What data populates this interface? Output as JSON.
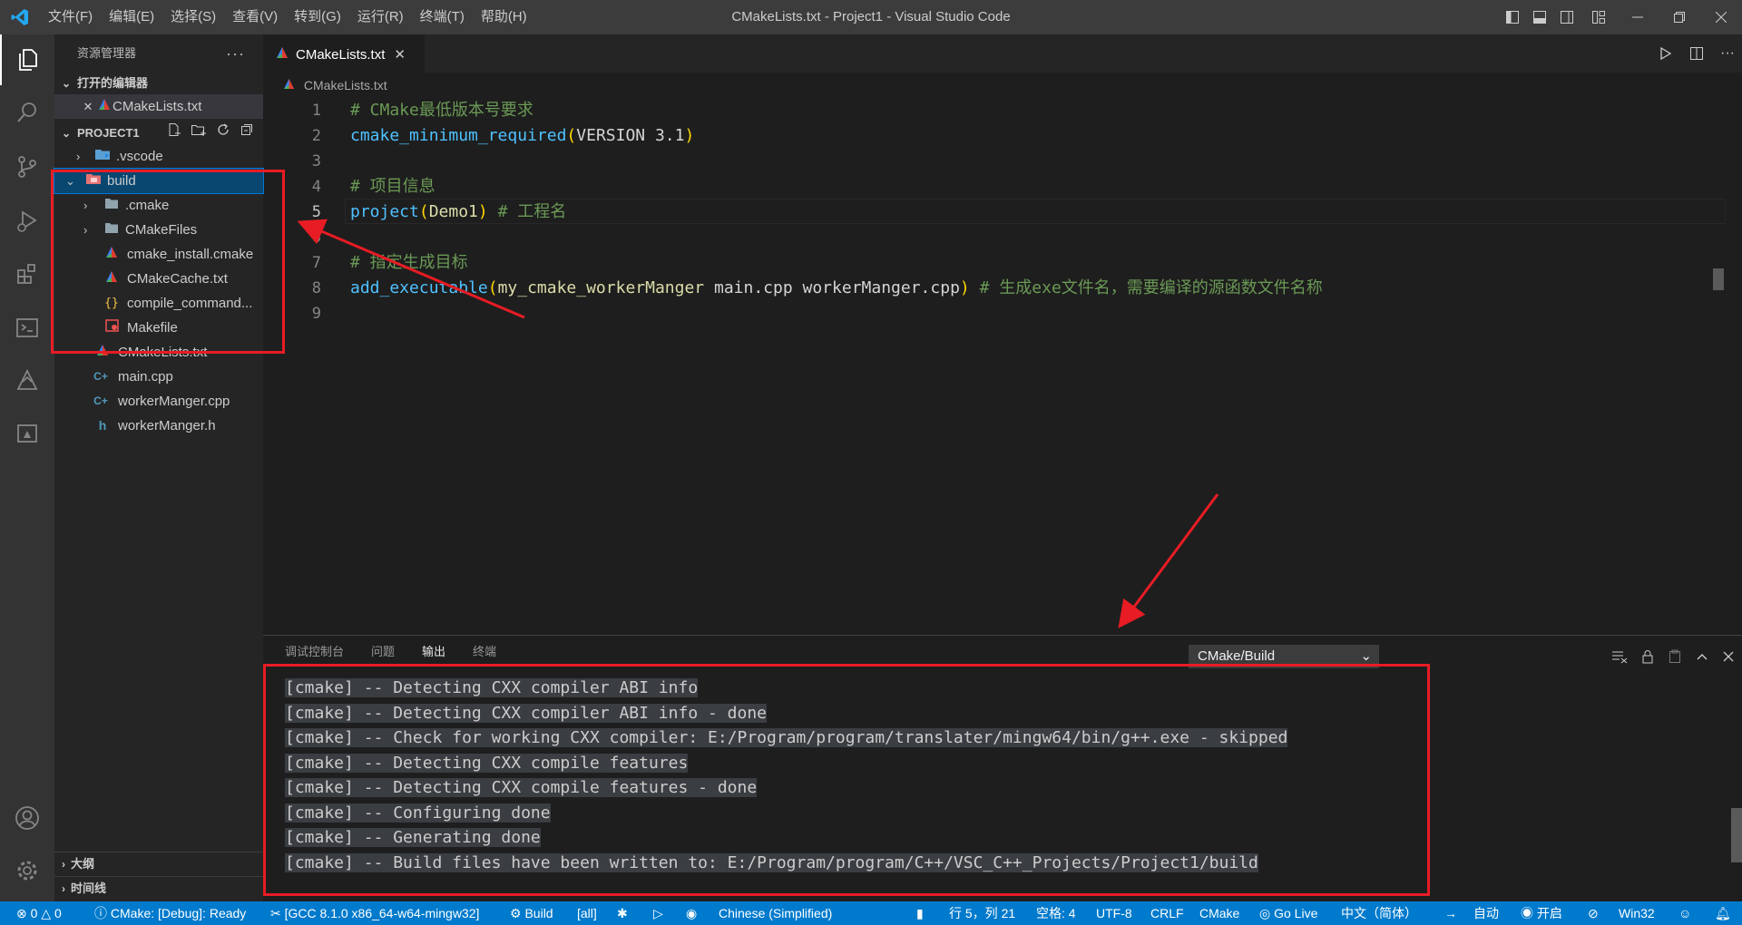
{
  "window": {
    "title": "CMakeLists.txt - Project1 - Visual Studio Code"
  },
  "menu": [
    "文件(F)",
    "编辑(E)",
    "选择(S)",
    "查看(V)",
    "转到(G)",
    "运行(R)",
    "终端(T)",
    "帮助(H)"
  ],
  "sidebar": {
    "title": "资源管理器",
    "open_editors_label": "打开的编辑器",
    "open_editor_file": "CMakeLists.txt",
    "project_label": "PROJECT1",
    "tree": [
      {
        "label": ".vscode",
        "indent": 1,
        "type": "folder-vscode"
      },
      {
        "label": "build",
        "indent": 1,
        "type": "folder-open"
      },
      {
        "label": ".cmake",
        "indent": 2,
        "type": "folder"
      },
      {
        "label": "CMakeFiles",
        "indent": 2,
        "type": "folder"
      },
      {
        "label": "cmake_install.cmake",
        "indent": 3,
        "type": "cmake"
      },
      {
        "label": "CMakeCache.txt",
        "indent": 3,
        "type": "cmake"
      },
      {
        "label": "compile_command...",
        "indent": 3,
        "type": "json"
      },
      {
        "label": "Makefile",
        "indent": 3,
        "type": "makefile"
      },
      {
        "label": "CMakeLists.txt",
        "indent": 2,
        "type": "cmake"
      },
      {
        "label": "main.cpp",
        "indent": 2,
        "type": "cpp"
      },
      {
        "label": "workerManger.cpp",
        "indent": 2,
        "type": "cpp"
      },
      {
        "label": "workerManger.h",
        "indent": 2,
        "type": "h"
      }
    ],
    "outline_label": "大纲",
    "timeline_label": "时间线"
  },
  "editor": {
    "tab_label": "CMakeLists.txt",
    "breadcrumb": "CMakeLists.txt",
    "current_line": 5,
    "lines": [
      "# CMake最低版本号要求",
      "cmake_minimum_required(VERSION 3.1)",
      "",
      "# 项目信息",
      "project(Demo1) # 工程名",
      "",
      "# 指定生成目标",
      "add_executable(my_cmake_workerManger main.cpp workerManger.cpp) # 生成exe文件名，需要编译的源函数文件名称",
      ""
    ]
  },
  "panel": {
    "tabs": [
      "调试控制台",
      "问题",
      "输出",
      "终端"
    ],
    "active_tab": "输出",
    "channel": "CMake/Build",
    "output": [
      "[cmake] -- Detecting CXX compiler ABI info",
      "[cmake] -- Detecting CXX compiler ABI info - done",
      "[cmake] -- Check for working CXX compiler: E:/Program/program/translater/mingw64/bin/g++.exe - skipped",
      "[cmake] -- Detecting CXX compile features",
      "[cmake] -- Detecting CXX compile features - done",
      "[cmake] -- Configuring done",
      "[cmake] -- Generating done",
      "[cmake] -- Build files have been written to: E:/Program/program/C++/VSC_C++_Projects/Project1/build"
    ]
  },
  "statusbar": {
    "errors": "0",
    "warnings": "0",
    "cmake_status": "CMake: [Debug]: Ready",
    "kit": "[GCC 8.1.0 x86_64-w64-mingw32]",
    "build": "Build",
    "target": "[all]",
    "language_pack": "Chinese (Simplified)",
    "position": "行 5，列 21",
    "spaces": "空格: 4",
    "encoding": "UTF-8",
    "eol": "CRLF",
    "language": "CMake",
    "golive": "Go Live",
    "ime": "中文（简体）",
    "auto": "自动",
    "open": "开启",
    "platform": "Win32"
  },
  "colors": {
    "accent": "#007acc",
    "annotation": "#e81c24",
    "selection": "#094771"
  }
}
